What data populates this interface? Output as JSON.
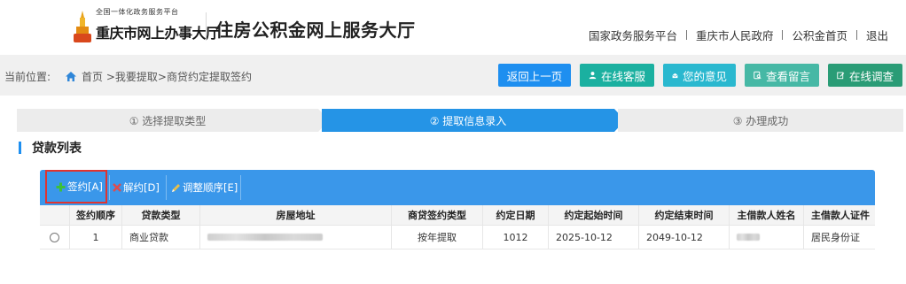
{
  "header": {
    "logo_small": "全国一体化政务服务平台",
    "logo_big": "重庆市网上办事大厅",
    "site_title": "住房公积金网上服务大厅",
    "links": [
      "国家政务服务平台",
      "重庆市人民政府",
      "公积金首页",
      "退出"
    ]
  },
  "breadcrumb": {
    "prefix": "当前位置:",
    "path": "首页 >我要提取>商贷约定提取签约"
  },
  "actions": {
    "back": "返回上一页",
    "service": "在线客服",
    "opinion": "您的意见",
    "message": "查看留言",
    "survey": "在线调查"
  },
  "steps": [
    "① 选择提取类型",
    "② 提取信息录入",
    "③ 办理成功"
  ],
  "section_title": "贷款列表",
  "toolbar": {
    "sign": "签约[A]",
    "unsign": "解约[D]",
    "reorder": "调整顺序[E]"
  },
  "table": {
    "headers": [
      "签约顺序",
      "贷款类型",
      "房屋地址",
      "商贷签约类型",
      "约定日期",
      "约定起始时间",
      "约定结束时间",
      "主借款人姓名",
      "主借款人证件"
    ],
    "rows": [
      {
        "order": "1",
        "loan_type": "商业贷款",
        "sign_type": "按年提取",
        "agreed_date": "1012",
        "start": "2025-10-12",
        "end": "2049-10-12",
        "id_type": "居民身份证"
      }
    ]
  },
  "colors": {
    "primary": "#1e8ff0",
    "toolbar": "#3a97ea",
    "highlight": "#e0332f"
  }
}
